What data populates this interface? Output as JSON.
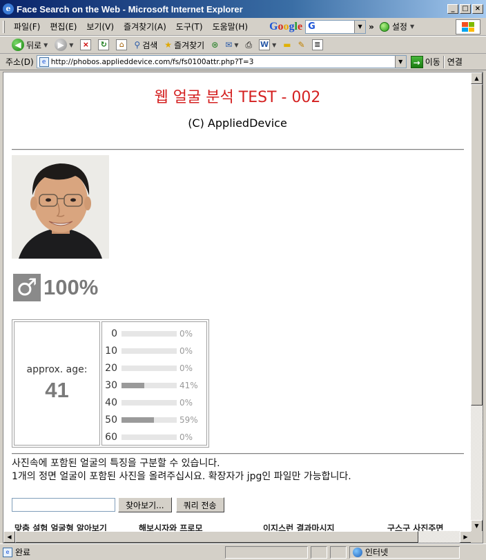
{
  "window": {
    "title": "Face Search on the Web - Microsoft Internet Explorer",
    "minimize": "_",
    "maximize": "□",
    "close": "×"
  },
  "menu": {
    "items": [
      "파일(F)",
      "편집(E)",
      "보기(V)",
      "즐겨찾기(A)",
      "도구(T)",
      "도움말(H)"
    ],
    "google_select_value": "G",
    "chevron": "»",
    "settings_label": "설정"
  },
  "toolbar": {
    "back_label": "뒤로",
    "search_label": "검색",
    "favorites_label": "즐겨찾기"
  },
  "address": {
    "label": "주소(D)",
    "url": "http://phobos.applieddevice.com/fs/fs0100attr.php?T=3",
    "go_label": "이동",
    "links_label": "연결"
  },
  "page": {
    "heading": "웹 얼굴 분석 TEST - 002",
    "copyright": "(C) AppliedDevice",
    "gender_symbol": "♂",
    "gender_percent": "100%",
    "age_label": "approx. age:",
    "age_value": "41",
    "age_bins": [
      {
        "label": "0",
        "fraction": 0.0,
        "percent": "0%"
      },
      {
        "label": "10",
        "fraction": 0.0,
        "percent": "0%"
      },
      {
        "label": "20",
        "fraction": 0.0,
        "percent": "0%"
      },
      {
        "label": "30",
        "fraction": 0.41,
        "percent": "41%"
      },
      {
        "label": "40",
        "fraction": 0.0,
        "percent": "0%"
      },
      {
        "label": "50",
        "fraction": 0.59,
        "percent": "59%"
      },
      {
        "label": "60",
        "fraction": 0.0,
        "percent": "0%"
      }
    ],
    "description_line1": "사진속에 포함된 얼굴의 특징을 구분할 수 있습니다.",
    "description_line2": "1개의 정면 얼굴이 포함된 사진을 올려주십시요. 확장자가 jpg인 파일만 가능합니다.",
    "browse_button": "찾아보기...",
    "submit_button": "쿼리 전송",
    "bottom_links": [
      "맞춤 설험 얼굴형 알아보기",
      "해보시자와 프로모",
      "이지스런 결과마시지",
      "구스구 사진주면"
    ]
  },
  "status": {
    "text": "완료",
    "zone": "인터넷"
  },
  "colors": {
    "heading": "#d42020",
    "bar_fill": "#9a9a9a",
    "titlebar_start": "#0a246a",
    "titlebar_end": "#a6caf0"
  }
}
